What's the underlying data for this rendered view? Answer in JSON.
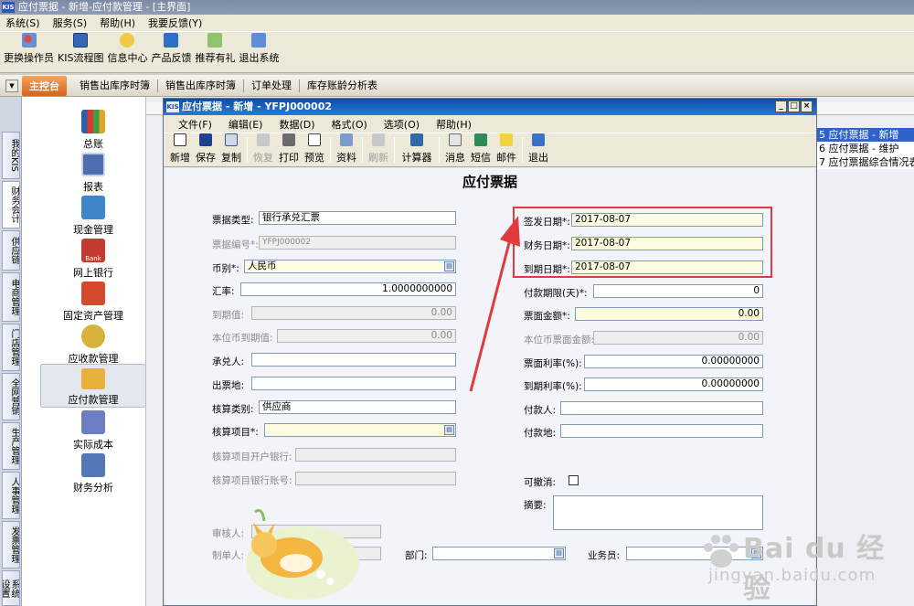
{
  "main_title": "应付票据 - 新增-应付款管理 - [主界面]",
  "kis_badge": "KIS",
  "main_menu": [
    "系统(S)",
    "服务(S)",
    "帮助(H)",
    "我要反馈(Y)"
  ],
  "main_toolbar": [
    "更换操作员",
    "KIS流程图",
    "信息中心",
    "产品反馈",
    "推荐有礼",
    "退出系统"
  ],
  "nav": {
    "home": "主控台",
    "links": [
      "销售出库序时簿",
      "销售出库序时簿",
      "订单处理",
      "库存账龄分析表"
    ]
  },
  "left_tabs": [
    "我的KIS",
    "财务会计",
    "供应链",
    "电商管理",
    "门店管理",
    "全网营销",
    "生产管理",
    "人事管理",
    "发票管理",
    "系统设置"
  ],
  "modules": [
    "总账",
    "报表",
    "现金管理",
    "网上银行",
    "固定资产管理",
    "应收款管理",
    "应付款管理",
    "实际成本",
    "财务分析"
  ],
  "module_bank_text": "Bank",
  "right_list": [
    "5 应付票据 - 新增",
    "6 应付票据 - 维护",
    "7 应付票据综合情况表"
  ],
  "child": {
    "title": "应付票据 - 新增 - YFPJ000002",
    "menu": [
      "文件(F)",
      "编辑(E)",
      "数据(D)",
      "格式(O)",
      "选项(O)",
      "帮助(H)"
    ],
    "window_buttons": [
      "_",
      "□",
      "×"
    ],
    "toolbar": [
      {
        "label": "新增",
        "icon": "new-doc-icon",
        "disabled": false
      },
      {
        "label": "保存",
        "icon": "save-icon",
        "disabled": false
      },
      {
        "label": "复制",
        "icon": "copy-icon",
        "disabled": false
      },
      {
        "label": "恢复",
        "icon": "undo-icon",
        "disabled": true
      },
      {
        "label": "打印",
        "icon": "print-icon",
        "disabled": false
      },
      {
        "label": "预览",
        "icon": "preview-icon",
        "disabled": false
      },
      {
        "label": "资料",
        "icon": "data-icon",
        "disabled": false
      },
      {
        "label": "刷新",
        "icon": "refresh-icon",
        "disabled": true
      },
      {
        "label": "计算器",
        "icon": "calculator-icon",
        "disabled": false
      },
      {
        "label": "消息",
        "icon": "message-icon",
        "disabled": false
      },
      {
        "label": "短信",
        "icon": "sms-icon",
        "disabled": false
      },
      {
        "label": "邮件",
        "icon": "mail-icon",
        "disabled": false
      },
      {
        "label": "退出",
        "icon": "exit-icon",
        "disabled": false
      }
    ]
  },
  "form": {
    "title": "应付票据",
    "bill_type": {
      "label": "票据类型:",
      "value": "银行承兑汇票"
    },
    "bill_no": {
      "label": "票据编号*:",
      "value": "YFPJ000002"
    },
    "currency": {
      "label": "币别*:",
      "value": "人民币"
    },
    "rate": {
      "label": "汇率:",
      "value": "1.0000000000"
    },
    "due_value": {
      "label": "到期值:",
      "value": "0.00"
    },
    "local_due_value": {
      "label": "本位币到期值:",
      "value": "0.00"
    },
    "acceptor": {
      "label": "承兑人:",
      "value": ""
    },
    "issue_place": {
      "label": "出票地:",
      "value": ""
    },
    "acct_category": {
      "label": "核算类别:",
      "value": "供应商"
    },
    "acct_item": {
      "label": "核算项目*:",
      "value": ""
    },
    "acct_bank": {
      "label": "核算项目开户银行:",
      "value": ""
    },
    "acct_account": {
      "label": "核算项目银行账号:",
      "value": ""
    },
    "reviewer": {
      "label": "审核人:",
      "value": ""
    },
    "maker": {
      "label": "制单人:",
      "value": ""
    },
    "department": {
      "label": "部门:",
      "value": ""
    },
    "salesperson": {
      "label": "业务员:",
      "value": ""
    },
    "issue_date": {
      "label": "签发日期*:",
      "value": "2017-08-07"
    },
    "finance_date": {
      "label": "财务日期*:",
      "value": "2017-08-07"
    },
    "maturity_date": {
      "label": "到期日期*:",
      "value": "2017-08-07"
    },
    "payment_term": {
      "label": "付款期限(天)*:",
      "value": "0"
    },
    "face_amount": {
      "label": "票面金额*:",
      "value": "0.00"
    },
    "local_face_amount": {
      "label": "本位币票面金额:",
      "value": "0.00"
    },
    "face_rate": {
      "label": "票面利率(%):",
      "value": "0.00000000"
    },
    "maturity_rate": {
      "label": "到期利率(%):",
      "value": "0.00000000"
    },
    "payer": {
      "label": "付款人:",
      "value": ""
    },
    "pay_place": {
      "label": "付款地:",
      "value": ""
    },
    "cancellable": {
      "label": "可撤消:",
      "checked": false
    },
    "summary": {
      "label": "摘要:",
      "value": ""
    }
  },
  "watermark": {
    "brand": "Bai du 经验",
    "url": "jingyan.baidu.com"
  },
  "colors": {
    "highlight": "#e23a3f",
    "required_field": "#fdfbe0",
    "title_bar": "#0c4ea6"
  }
}
